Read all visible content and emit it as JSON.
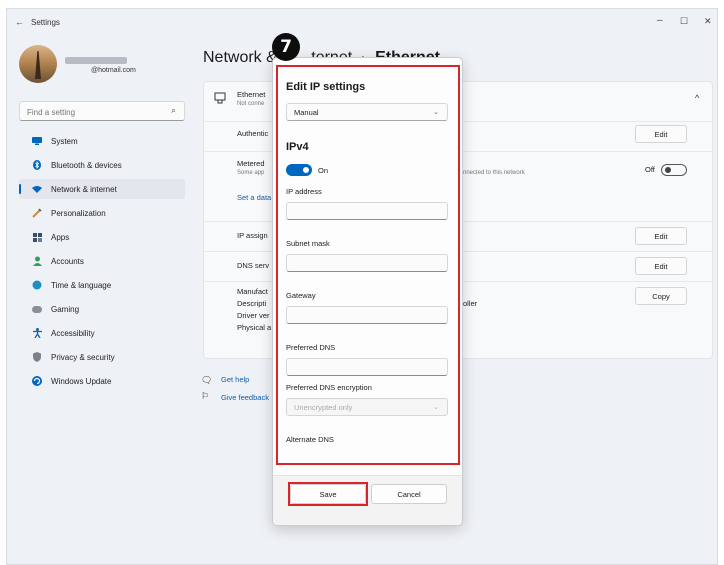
{
  "window": {
    "title": "Settings",
    "back_icon": "back-arrow-icon",
    "controls": {
      "minimize": "–",
      "maximize": "☐",
      "close": "✕"
    }
  },
  "account": {
    "email": "@hotmail.com"
  },
  "search": {
    "placeholder": "Find a setting"
  },
  "sidebar": {
    "items": [
      {
        "label": "System",
        "icon": "monitor-icon",
        "color": "#0067c0"
      },
      {
        "label": "Bluetooth & devices",
        "icon": "bluetooth-icon",
        "color": "#0067c0"
      },
      {
        "label": "Network & internet",
        "icon": "wifi-icon",
        "color": "#0067c0",
        "active": true
      },
      {
        "label": "Personalization",
        "icon": "brush-icon",
        "color": "#d08a3a"
      },
      {
        "label": "Apps",
        "icon": "apps-icon",
        "color": "#3a4d6b"
      },
      {
        "label": "Accounts",
        "icon": "person-icon",
        "color": "#2c9f5b"
      },
      {
        "label": "Time & language",
        "icon": "globe-clock-icon",
        "color": "#1a8cd8"
      },
      {
        "label": "Gaming",
        "icon": "gamepad-icon",
        "color": "#7a7a7a"
      },
      {
        "label": "Accessibility",
        "icon": "accessibility-icon",
        "color": "#1560a8"
      },
      {
        "label": "Privacy & security",
        "icon": "shield-icon",
        "color": "#6b6f78"
      },
      {
        "label": "Windows Update",
        "icon": "update-icon",
        "color": "#0067c0"
      }
    ]
  },
  "header": {
    "crumb_parent": "Network &",
    "crumb_parent_tail": "ternet",
    "separator": "›",
    "current": "Ethernet"
  },
  "ethernet_card": {
    "title": "Ethernet",
    "subtitle": "Not conne",
    "rows": {
      "auth": "Authentic",
      "metered": "Metered",
      "metered_sub": "Some app",
      "metered_sub_tail": "nnected to this network",
      "metered_toggle": "Off",
      "data_link": "Set a data",
      "ip_assign": "IP assign",
      "dns_server": "DNS serv",
      "manufacturer": "Manufact",
      "description": "Descripti",
      "description_tail": "oller",
      "driver": "Driver ver",
      "physical": "Physical a"
    },
    "buttons": {
      "edit1": "Edit",
      "edit2": "Edit",
      "edit3": "Edit",
      "copy": "Copy"
    }
  },
  "help": {
    "get_help": "Get help",
    "feedback": "Give feedback"
  },
  "dialog": {
    "step_number": "7",
    "title": "Edit IP settings",
    "mode_selected": "Manual",
    "section": "IPv4",
    "ipv4_toggle": "On",
    "fields": {
      "ip_address": "IP address",
      "subnet_mask": "Subnet mask",
      "gateway": "Gateway",
      "preferred_dns": "Preferred DNS",
      "preferred_dns_encryption": "Preferred DNS encryption",
      "encryption_selected": "Unencrypted only",
      "alternate_dns": "Alternate DNS"
    },
    "save": "Save",
    "cancel": "Cancel",
    "highlight_color": "#d8252b"
  }
}
